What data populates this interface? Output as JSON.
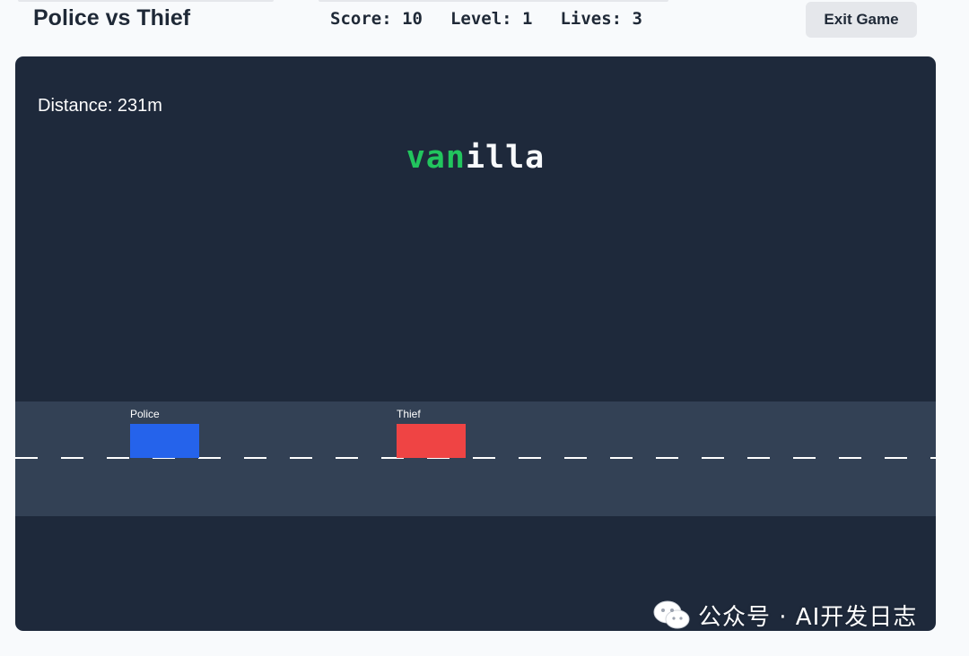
{
  "header": {
    "title": "Police vs Thief",
    "score": "Score: 10",
    "level": "Level: 1",
    "lives": "Lives: 3",
    "exit_label": "Exit Game"
  },
  "game": {
    "distance": "Distance: 231m",
    "word": {
      "typed": "van",
      "remaining": "illa"
    },
    "police": {
      "label": "Police",
      "color": "#2563eb"
    },
    "thief": {
      "label": "Thief",
      "color": "#ef4444"
    },
    "colors": {
      "background": "#1e293b",
      "road": "#334155",
      "typed": "#22c55e"
    }
  },
  "watermark": {
    "icon": "wechat-icon",
    "text": "公众号 · AI开发日志"
  }
}
